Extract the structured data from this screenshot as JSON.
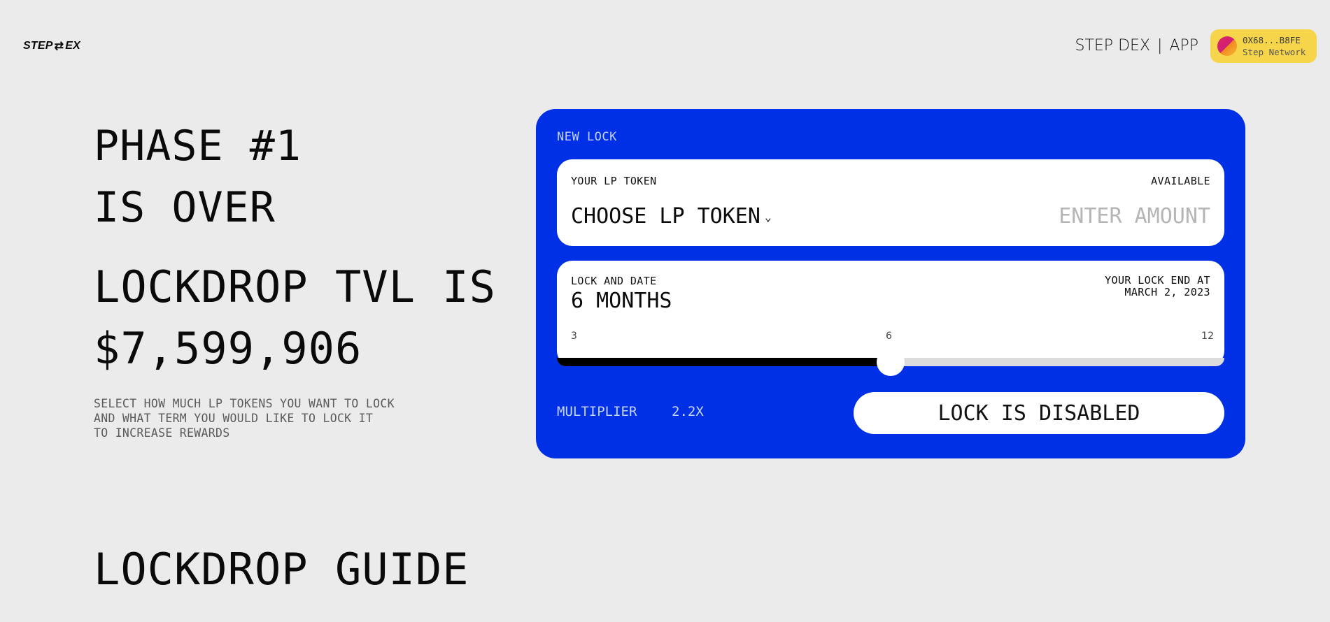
{
  "header": {
    "logo_left": "STEP",
    "logo_symbol": "⇄",
    "logo_right": "EX",
    "nav_left": "STEP DEX",
    "nav_separator": "|",
    "nav_right": "APP",
    "wallet": {
      "address": "0X68...B8FE",
      "network": "Step Network"
    }
  },
  "hero": {
    "phase_line1": "PHASE #1",
    "phase_line2": "IS OVER",
    "tvl_line1": "LOCKDROP TVL IS",
    "tvl_line2": "$7,599,906",
    "description": "SELECT HOW MUCH LP TOKENS YOU WANT TO LOCK\nAND WHAT TERM YOU WOULD LIKE TO LOCK IT\nTO INCREASE REWARDS"
  },
  "lock_card": {
    "title": "NEW LOCK",
    "token_panel": {
      "label": "YOUR LP TOKEN",
      "available_label": "AVAILABLE",
      "choose_label": "CHOOSE LP TOKEN",
      "amount_placeholder": "ENTER AMOUNT"
    },
    "lock_panel": {
      "label": "LOCK AND DATE",
      "value": "6 MONTHS",
      "end_label": "YOUR LOCK END AT",
      "end_date": "MARCH 2, 2023",
      "ticks": [
        "3",
        "6",
        "12"
      ],
      "slider_value_months": 6,
      "slider_min": 3,
      "slider_max": 12,
      "slider_fraction": 0.5
    },
    "multiplier_label": "MULTIPLIER",
    "multiplier_value": "2.2X",
    "lock_button": "LOCK IS DISABLED"
  },
  "guide": {
    "title": "LOCKDROP GUIDE"
  },
  "colors": {
    "background": "#ebebeb",
    "card": "#0030e6",
    "wallet": "#f7d54a"
  }
}
